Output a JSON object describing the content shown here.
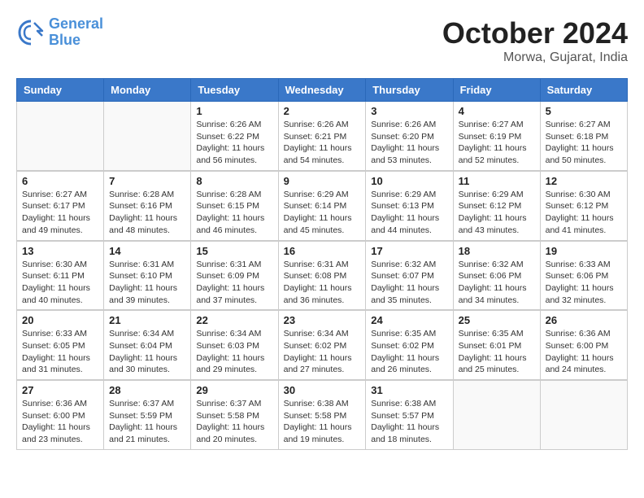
{
  "logo": {
    "line1": "General",
    "line2": "Blue"
  },
  "title": "October 2024",
  "location": "Morwa, Gujarat, India",
  "days_header": [
    "Sunday",
    "Monday",
    "Tuesday",
    "Wednesday",
    "Thursday",
    "Friday",
    "Saturday"
  ],
  "weeks": [
    [
      {
        "day": "",
        "info": ""
      },
      {
        "day": "",
        "info": ""
      },
      {
        "day": "1",
        "info": "Sunrise: 6:26 AM\nSunset: 6:22 PM\nDaylight: 11 hours and 56 minutes."
      },
      {
        "day": "2",
        "info": "Sunrise: 6:26 AM\nSunset: 6:21 PM\nDaylight: 11 hours and 54 minutes."
      },
      {
        "day": "3",
        "info": "Sunrise: 6:26 AM\nSunset: 6:20 PM\nDaylight: 11 hours and 53 minutes."
      },
      {
        "day": "4",
        "info": "Sunrise: 6:27 AM\nSunset: 6:19 PM\nDaylight: 11 hours and 52 minutes."
      },
      {
        "day": "5",
        "info": "Sunrise: 6:27 AM\nSunset: 6:18 PM\nDaylight: 11 hours and 50 minutes."
      }
    ],
    [
      {
        "day": "6",
        "info": "Sunrise: 6:27 AM\nSunset: 6:17 PM\nDaylight: 11 hours and 49 minutes."
      },
      {
        "day": "7",
        "info": "Sunrise: 6:28 AM\nSunset: 6:16 PM\nDaylight: 11 hours and 48 minutes."
      },
      {
        "day": "8",
        "info": "Sunrise: 6:28 AM\nSunset: 6:15 PM\nDaylight: 11 hours and 46 minutes."
      },
      {
        "day": "9",
        "info": "Sunrise: 6:29 AM\nSunset: 6:14 PM\nDaylight: 11 hours and 45 minutes."
      },
      {
        "day": "10",
        "info": "Sunrise: 6:29 AM\nSunset: 6:13 PM\nDaylight: 11 hours and 44 minutes."
      },
      {
        "day": "11",
        "info": "Sunrise: 6:29 AM\nSunset: 6:12 PM\nDaylight: 11 hours and 43 minutes."
      },
      {
        "day": "12",
        "info": "Sunrise: 6:30 AM\nSunset: 6:12 PM\nDaylight: 11 hours and 41 minutes."
      }
    ],
    [
      {
        "day": "13",
        "info": "Sunrise: 6:30 AM\nSunset: 6:11 PM\nDaylight: 11 hours and 40 minutes."
      },
      {
        "day": "14",
        "info": "Sunrise: 6:31 AM\nSunset: 6:10 PM\nDaylight: 11 hours and 39 minutes."
      },
      {
        "day": "15",
        "info": "Sunrise: 6:31 AM\nSunset: 6:09 PM\nDaylight: 11 hours and 37 minutes."
      },
      {
        "day": "16",
        "info": "Sunrise: 6:31 AM\nSunset: 6:08 PM\nDaylight: 11 hours and 36 minutes."
      },
      {
        "day": "17",
        "info": "Sunrise: 6:32 AM\nSunset: 6:07 PM\nDaylight: 11 hours and 35 minutes."
      },
      {
        "day": "18",
        "info": "Sunrise: 6:32 AM\nSunset: 6:06 PM\nDaylight: 11 hours and 34 minutes."
      },
      {
        "day": "19",
        "info": "Sunrise: 6:33 AM\nSunset: 6:06 PM\nDaylight: 11 hours and 32 minutes."
      }
    ],
    [
      {
        "day": "20",
        "info": "Sunrise: 6:33 AM\nSunset: 6:05 PM\nDaylight: 11 hours and 31 minutes."
      },
      {
        "day": "21",
        "info": "Sunrise: 6:34 AM\nSunset: 6:04 PM\nDaylight: 11 hours and 30 minutes."
      },
      {
        "day": "22",
        "info": "Sunrise: 6:34 AM\nSunset: 6:03 PM\nDaylight: 11 hours and 29 minutes."
      },
      {
        "day": "23",
        "info": "Sunrise: 6:34 AM\nSunset: 6:02 PM\nDaylight: 11 hours and 27 minutes."
      },
      {
        "day": "24",
        "info": "Sunrise: 6:35 AM\nSunset: 6:02 PM\nDaylight: 11 hours and 26 minutes."
      },
      {
        "day": "25",
        "info": "Sunrise: 6:35 AM\nSunset: 6:01 PM\nDaylight: 11 hours and 25 minutes."
      },
      {
        "day": "26",
        "info": "Sunrise: 6:36 AM\nSunset: 6:00 PM\nDaylight: 11 hours and 24 minutes."
      }
    ],
    [
      {
        "day": "27",
        "info": "Sunrise: 6:36 AM\nSunset: 6:00 PM\nDaylight: 11 hours and 23 minutes."
      },
      {
        "day": "28",
        "info": "Sunrise: 6:37 AM\nSunset: 5:59 PM\nDaylight: 11 hours and 21 minutes."
      },
      {
        "day": "29",
        "info": "Sunrise: 6:37 AM\nSunset: 5:58 PM\nDaylight: 11 hours and 20 minutes."
      },
      {
        "day": "30",
        "info": "Sunrise: 6:38 AM\nSunset: 5:58 PM\nDaylight: 11 hours and 19 minutes."
      },
      {
        "day": "31",
        "info": "Sunrise: 6:38 AM\nSunset: 5:57 PM\nDaylight: 11 hours and 18 minutes."
      },
      {
        "day": "",
        "info": ""
      },
      {
        "day": "",
        "info": ""
      }
    ]
  ]
}
